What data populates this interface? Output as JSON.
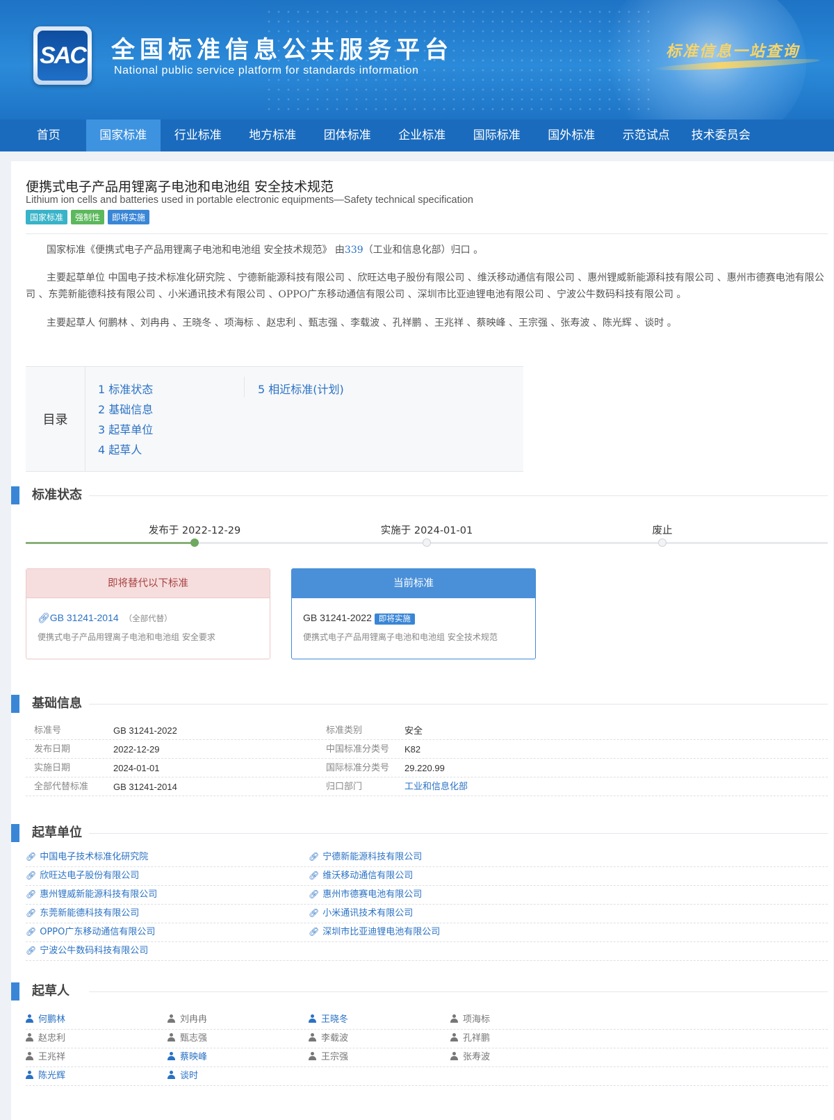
{
  "site": {
    "logo_text": "SAC",
    "title": "全国标准信息公共服务平台",
    "subtitle": "National public service platform  for standards information",
    "slogan": "标准信息一站查询"
  },
  "nav": [
    "首页",
    "国家标准",
    "行业标准",
    "地方标准",
    "团体标准",
    "企业标准",
    "国际标准",
    "国外标准",
    "示范试点",
    "技术委员会"
  ],
  "nav_active": "国家标准",
  "standard": {
    "title": "便携式电子产品用锂离子电池和电池组 安全技术规范",
    "title_en": "Lithium ion cells and batteries used in portable electronic equipments—Safety technical specification",
    "badges": [
      "国家标准",
      "强制性",
      "即将实施"
    ]
  },
  "intro": {
    "p1_a": "国家标准《便携式电子产品用锂离子电池和电池组 安全技术规范》 由",
    "p1_link": "339",
    "p1_b": "（工业和信息化部）归口 。",
    "p2": "主要起草单位 中国电子技术标准化研究院 、宁德新能源科技有限公司 、欣旺达电子股份有限公司 、维沃移动通信有限公司 、惠州锂威新能源科技有限公司 、惠州市德赛电池有限公司 、东莞新能德科技有限公司 、小米通讯技术有限公司 、OPPO广东移动通信有限公司 、深圳市比亚迪锂电池有限公司 、宁波公牛数码科技有限公司 。",
    "p3": "主要起草人 何鹏林 、刘冉冉 、王晓冬 、项海标 、赵忠利 、甄志强 、李载波 、孔祥鹏 、王兆祥 、蔡映峰 、王宗强 、张寿波 、陈光辉 、谈时 。"
  },
  "toc": {
    "label": "目录",
    "items": [
      "1  标准状态",
      "2  基础信息",
      "3  起草单位",
      "4  起草人",
      "5  相近标准(计划)"
    ]
  },
  "sections": {
    "status": "标准状态",
    "basic": "基础信息",
    "units": "起草单位",
    "drafters": "起草人"
  },
  "timeline": {
    "published": "发布于 2022-12-29",
    "effective": "实施于 2024-01-01",
    "abolished": "废止",
    "progress_stage": 1
  },
  "replace": {
    "header": "即将替代以下标准",
    "code": "GB 31241-2014",
    "note": "（全部代替）",
    "desc": "便携式电子产品用锂离子电池和电池组 安全要求"
  },
  "current": {
    "header": "当前标准",
    "code": "GB 31241-2022",
    "tag": "即将实施",
    "desc": "便携式电子产品用锂离子电池和电池组 安全技术规范"
  },
  "basic_info": [
    {
      "k1": "标准号",
      "v1": "GB 31241-2022",
      "k2": "标准类别",
      "v2": "安全"
    },
    {
      "k1": "发布日期",
      "v1": "2022-12-29",
      "k2": "中国标准分类号",
      "v2": "K82"
    },
    {
      "k1": "实施日期",
      "v1": "2024-01-01",
      "k2": "国际标准分类号",
      "v2": "29.220.99"
    },
    {
      "k1": "全部代替标准",
      "v1": "GB 31241-2014",
      "k2": "归口部门",
      "v2": "工业和信息化部"
    }
  ],
  "units": [
    "中国电子技术标准化研究院",
    "宁德新能源科技有限公司",
    "欣旺达电子股份有限公司",
    "维沃移动通信有限公司",
    "惠州锂威新能源科技有限公司",
    "惠州市德赛电池有限公司",
    "东莞新能德科技有限公司",
    "小米通讯技术有限公司",
    "OPPO广东移动通信有限公司",
    "深圳市比亚迪锂电池有限公司",
    "宁波公牛数码科技有限公司"
  ],
  "drafters": [
    {
      "name": "何鹏林",
      "linked": true
    },
    {
      "name": "刘冉冉",
      "linked": false
    },
    {
      "name": "王晓冬",
      "linked": true
    },
    {
      "name": "项海标",
      "linked": false
    },
    {
      "name": "赵忠利",
      "linked": false
    },
    {
      "name": "甄志强",
      "linked": false
    },
    {
      "name": "李载波",
      "linked": false
    },
    {
      "name": "孔祥鹏",
      "linked": false
    },
    {
      "name": "王兆祥",
      "linked": false
    },
    {
      "name": "蔡映峰",
      "linked": true
    },
    {
      "name": "王宗强",
      "linked": false
    },
    {
      "name": "张寿波",
      "linked": false
    },
    {
      "name": "陈光辉",
      "linked": true
    },
    {
      "name": "谈时",
      "linked": true
    }
  ]
}
